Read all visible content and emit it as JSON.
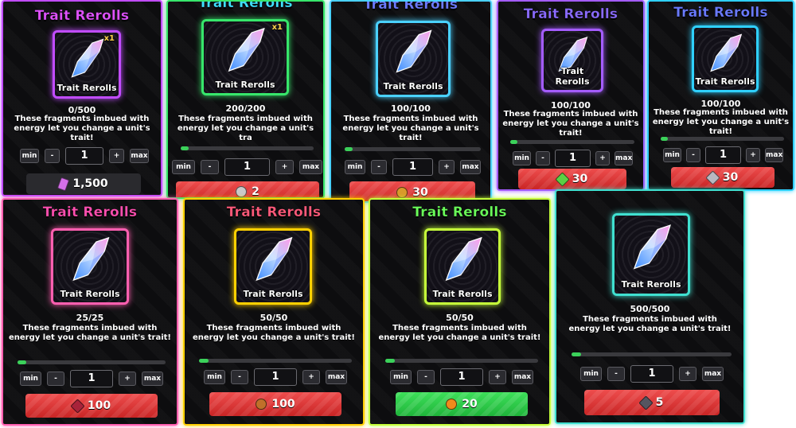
{
  "cards": [
    {
      "title": "Trait Rerolls",
      "title_color": "#e052ff",
      "frame": "#c14cff",
      "icon_label": "Trait Rerolls",
      "quantity_badge": "x1",
      "count": "0/500",
      "desc": "These fragments imbued with\nenergy let you change a unit's trait!",
      "progress": 0,
      "min_label": "min",
      "minus_label": "-",
      "amount": "1",
      "plus_label": "+",
      "max_label": "max",
      "price": "1,500",
      "currency_icon": "fragment-icon",
      "currency_color": "#d46fe8",
      "button_style": "dark"
    },
    {
      "title": "Trait Rerolls",
      "title_color": "#40e0ff",
      "frame": "#37e66b",
      "icon_label": "Trait Rerolls",
      "quantity_badge": "x1",
      "count": "200/200",
      "desc": "These fragments imbued with\nenergy let you change a unit's tra",
      "progress": 1,
      "min_label": "min",
      "minus_label": "-",
      "amount": "1",
      "plus_label": "+",
      "max_label": "max",
      "price": "2",
      "currency_icon": "silver-coin-icon",
      "currency_color": "#c9c9c9",
      "button_style": "red"
    },
    {
      "title": "Trait Rerolls",
      "title_color": "#6d7bff",
      "frame": "#4ad1ff",
      "icon_label": "Trait Rerolls",
      "quantity_badge": "",
      "count": "100/100",
      "desc": "These fragments imbued with\nenergy let you change a unit's trait!",
      "progress": 1,
      "min_label": "min",
      "minus_label": "-",
      "amount": "1",
      "plus_label": "+",
      "max_label": "max",
      "price": "30",
      "currency_icon": "gold-coin-icon",
      "currency_color": "#d99a2a",
      "button_style": "red"
    },
    {
      "title": "Trait Rerolls",
      "title_color": "#8a6bff",
      "frame": "#a45cff",
      "icon_label": "Trait Rerolls",
      "quantity_badge": "",
      "count": "100/100",
      "desc": "These fragments imbued with\nenergy let you change a unit's trait!",
      "progress": 1,
      "min_label": "min",
      "minus_label": "-",
      "amount": "1",
      "plus_label": "+",
      "max_label": "max",
      "price": "30",
      "currency_icon": "green-gem-icon",
      "currency_color": "#5ad044",
      "button_style": "red"
    },
    {
      "title": "Trait Rerolls",
      "title_color": "#6a7bff",
      "frame": "#2fd0ff",
      "icon_label": "Trait Rerolls",
      "quantity_badge": "",
      "count": "100/100",
      "desc": "These fragments imbued with\nenergy let you change a unit's trait!",
      "progress": 1,
      "min_label": "min",
      "minus_label": "-",
      "amount": "1",
      "plus_label": "+",
      "max_label": "max",
      "price": "30",
      "currency_icon": "silver-gem-icon",
      "currency_color": "#b8b8c0",
      "button_style": "red"
    },
    {
      "title": "Trait Rerolls",
      "title_color": "#ff4fb0",
      "frame": "#ff5fb0",
      "icon_label": "Trait Rerolls",
      "quantity_badge": "",
      "count": "25/25",
      "desc": "These fragments imbued with\nenergy let you change a unit's trait!",
      "progress": 1,
      "min_label": "min",
      "minus_label": "-",
      "amount": "1",
      "plus_label": "+",
      "max_label": "max",
      "price": "100",
      "currency_icon": "red-gem-icon",
      "currency_color": "#a8233a",
      "button_style": "red"
    },
    {
      "title": "Trait Rerolls",
      "title_color": "#ff5a7a",
      "frame": "#ffd000",
      "icon_label": "Trait Rerolls",
      "quantity_badge": "",
      "count": "50/50",
      "desc": "These fragments imbued with\nenergy let you change a unit's trait!",
      "progress": 1,
      "min_label": "min",
      "minus_label": "-",
      "amount": "1",
      "plus_label": "+",
      "max_label": "max",
      "price": "100",
      "currency_icon": "bronze-coin-icon",
      "currency_color": "#c0702a",
      "button_style": "red"
    },
    {
      "title": "Trait Rerolls",
      "title_color": "#6bff5a",
      "frame": "#c6ff3a",
      "icon_label": "Trait Rerolls",
      "quantity_badge": "",
      "count": "50/50",
      "desc": "These fragments imbued with\nenergy let you change a unit's trait!",
      "progress": 1,
      "min_label": "min",
      "minus_label": "-",
      "amount": "1",
      "plus_label": "+",
      "max_label": "max",
      "price": "20",
      "currency_icon": "orange-coin-icon",
      "currency_color": "#f08a1c",
      "button_style": "green"
    },
    {
      "title": "",
      "title_color": "#ffffff",
      "frame": "#40e0d0",
      "icon_label": "Trait Rerolls",
      "quantity_badge": "",
      "count": "500/500",
      "desc": "These fragments imbued with\nenergy let you change a unit's trait!",
      "progress": 1,
      "min_label": "min",
      "minus_label": "-",
      "amount": "1",
      "plus_label": "+",
      "max_label": "max",
      "price": "5",
      "currency_icon": "dark-gem-icon",
      "currency_color": "#555560",
      "button_style": "red"
    }
  ]
}
